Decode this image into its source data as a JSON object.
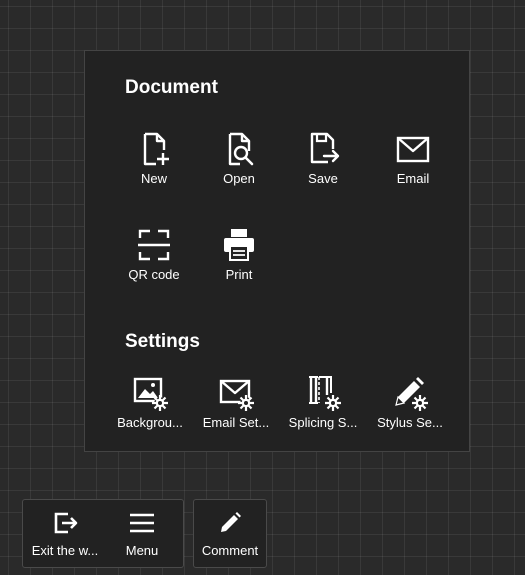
{
  "menu_panel": {
    "document_section": {
      "title": "Document",
      "items": [
        {
          "label": "New",
          "icon": "new-file-icon"
        },
        {
          "label": "Open",
          "icon": "open-file-icon"
        },
        {
          "label": "Save",
          "icon": "save-file-icon"
        },
        {
          "label": "Email",
          "icon": "email-icon"
        },
        {
          "label": "QR code",
          "icon": "qr-code-icon"
        },
        {
          "label": "Print",
          "icon": "printer-icon"
        }
      ]
    },
    "settings_section": {
      "title": "Settings",
      "items": [
        {
          "label": "Backgrou...",
          "icon": "background-settings-icon"
        },
        {
          "label": "Email Set...",
          "icon": "email-settings-icon"
        },
        {
          "label": "Splicing S...",
          "icon": "splicing-settings-icon"
        },
        {
          "label": "Stylus Se...",
          "icon": "stylus-settings-icon"
        }
      ]
    }
  },
  "bottom_toolbar": {
    "exit": {
      "label": "Exit the w...",
      "icon": "exit-icon"
    },
    "menu": {
      "label": "Menu",
      "icon": "menu-icon"
    },
    "comment": {
      "label": "Comment",
      "icon": "pen-icon"
    }
  },
  "colors": {
    "background": "#2a2a2a",
    "panel": "#222222",
    "icon": "#ffffff",
    "text": "#ffffff"
  }
}
